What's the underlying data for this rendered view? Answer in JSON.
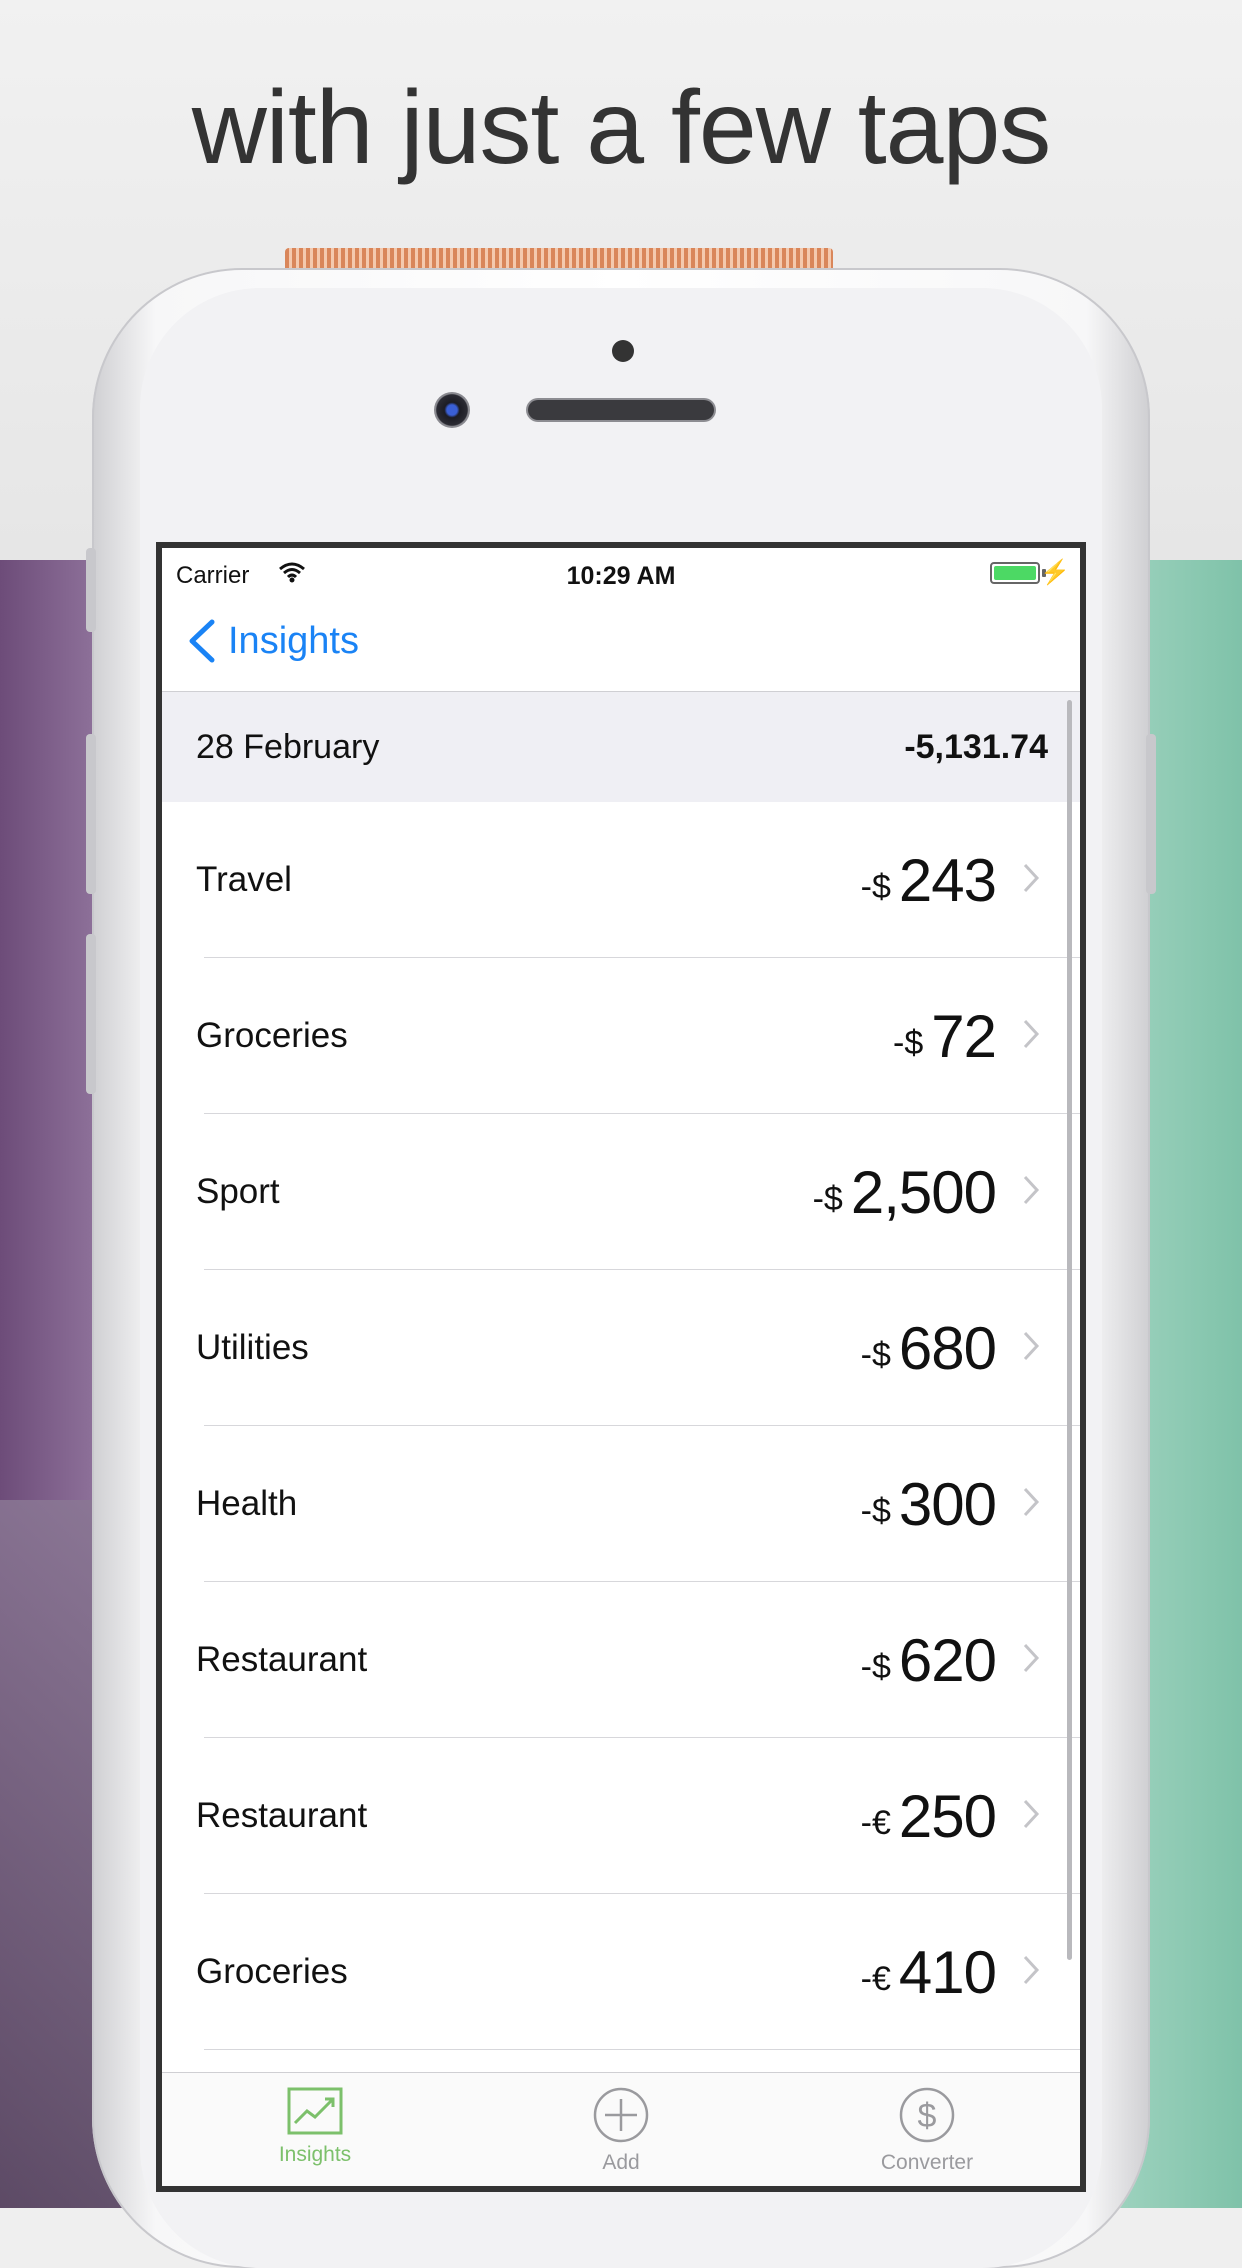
{
  "headline": "with just a few taps",
  "status_bar": {
    "carrier": "Carrier",
    "time": "10:29 AM"
  },
  "nav": {
    "back_label": "Insights"
  },
  "section": {
    "date": "28 February",
    "total": "-5,131.74"
  },
  "rows": [
    {
      "category": "Travel",
      "currency": "-$",
      "amount": "243"
    },
    {
      "category": "Groceries",
      "currency": "-$",
      "amount": "72"
    },
    {
      "category": "Sport",
      "currency": "-$",
      "amount": "2,500"
    },
    {
      "category": "Utilities",
      "currency": "-$",
      "amount": "680"
    },
    {
      "category": "Health",
      "currency": "-$",
      "amount": "300"
    },
    {
      "category": "Restaurant",
      "currency": "-$",
      "amount": "620"
    },
    {
      "category": "Restaurant",
      "currency": "-€",
      "amount": "250"
    },
    {
      "category": "Groceries",
      "currency": "-€",
      "amount": "410"
    }
  ],
  "tabs": [
    {
      "label": "Insights",
      "icon": "chart-icon",
      "active": true
    },
    {
      "label": "Add",
      "icon": "add-icon",
      "active": false
    },
    {
      "label": "Converter",
      "icon": "dollar-icon",
      "active": false
    }
  ],
  "colors": {
    "accent": "#1a83f5",
    "tab_active": "#7cc06b",
    "battery": "#4cd964"
  }
}
